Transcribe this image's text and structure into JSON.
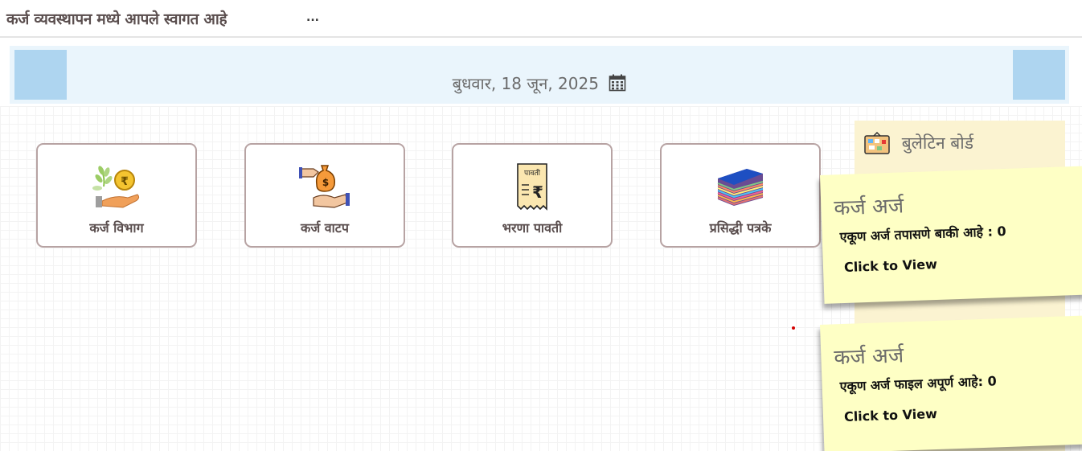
{
  "header": {
    "title": "कर्ज व्यवस्थापन मध्ये आपले स्वागत आहे",
    "more": "..."
  },
  "date_banner": {
    "date": "बुधवार, 18 जून, 2025",
    "icon": "calendar-icon"
  },
  "tiles": [
    {
      "label": "कर्ज विभाग",
      "icon": "crop-loan-icon"
    },
    {
      "label": "कर्ज वाटप",
      "icon": "money-bag-handover-icon"
    },
    {
      "label": "भरणा पावती",
      "icon": "receipt-icon",
      "icon_text": "पावती",
      "icon_symbol": "₹"
    },
    {
      "label": "प्रसिद्धी पत्रके",
      "icon": "paper-stack-icon"
    }
  ],
  "bulletin": {
    "title": "बुलेटिन बोर्ड",
    "icon": "bulletin-board-icon",
    "notes": [
      {
        "title": "कर्ज अर्ज",
        "text": "एकूण अर्ज तपासणे बाकी आहे : 0",
        "link": "Click to View"
      },
      {
        "title": "कर्ज अर्ज",
        "text": "एकूण अर्ज फाइल अपूर्ण आहे: 0",
        "link": "Click to View"
      }
    ]
  },
  "colors": {
    "tile_border": "#b7a3a3",
    "banner_bg": "#eaf5fc",
    "banner_corner": "#aed5f0",
    "note_bg": "#feffc5",
    "bulletin_bg": "#fbf3d1"
  }
}
